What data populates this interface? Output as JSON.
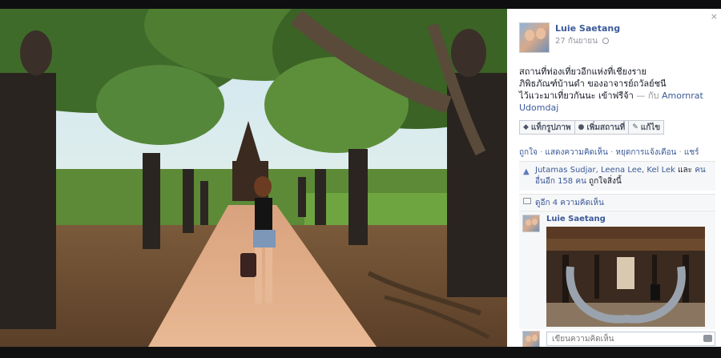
{
  "viewer": {
    "close_label": "×"
  },
  "post": {
    "author": "Luie Saetang",
    "date": "27 กันยายน",
    "caption_line1": "สถานที่ท่องเที่ยวอีกแห่งที่เชียงราย",
    "caption_line2": "ภิพิธภัณฑ์บ้านดำ ของอาจารย์ถวัลย์ชนี",
    "caption_line3": "ไว้แวะมาเที่ยวกันนะ เข้าฟรีจ้า",
    "caption_with": " — กับ ",
    "tagged_person": "Amornrat Udomdaj"
  },
  "actions": {
    "tag_photo": "แท็กรูปภาพ",
    "add_location": "เพิ่มสถานที่",
    "edit": "แก้ไข"
  },
  "links": {
    "like": "ถูกใจ",
    "comment": "แสดงความคิดเห็น",
    "stop_notifications": "หยุดการแจ้งเตือน",
    "share": "แชร์",
    "separator": " · "
  },
  "likes": {
    "names": "Jutamas Sudjar, Leena Lee, Kel Lek",
    "and_text": " และ ",
    "others": "คนอื่นอีก 158 คน",
    "liked_text": " ถูกใจสิ่งนี้"
  },
  "comments_summary": "ดูอีก 4 ความคิดเห็น",
  "comment": {
    "author": "Luie Saetang"
  },
  "comment_input": {
    "placeholder": "เขียนความคิดเห็น"
  },
  "icons": {
    "close": "close-icon",
    "globe": "globe-icon",
    "tag": "tag-icon",
    "location": "location-pin-icon",
    "edit": "pencil-icon",
    "like": "thumbs-up-icon",
    "comment": "comment-icon",
    "camera": "camera-icon"
  },
  "colors": {
    "link": "#3b5998",
    "panel_bg": "#ffffff",
    "theater_bg": "#0b0b0b"
  }
}
